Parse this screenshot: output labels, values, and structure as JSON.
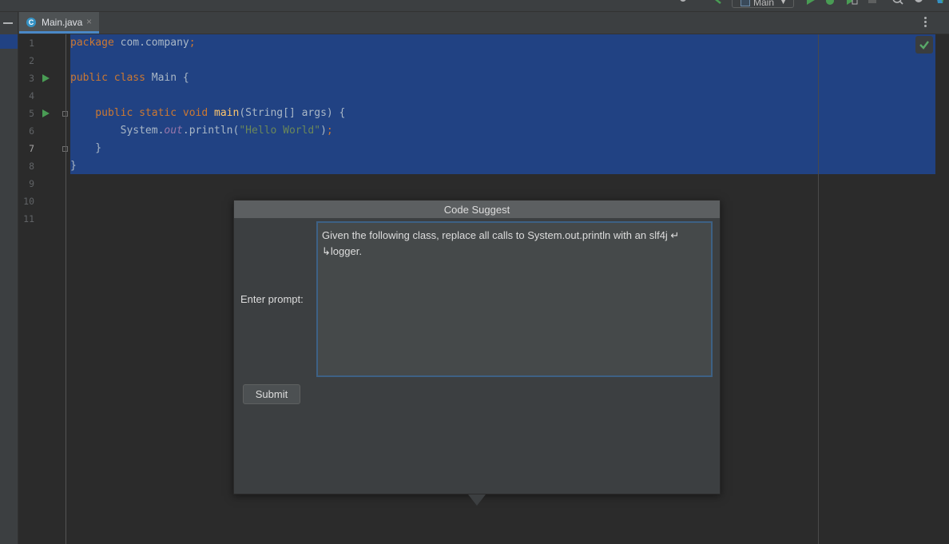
{
  "toolbar": {
    "run_config": "Main"
  },
  "tab": {
    "label": "Main.java",
    "close": "×",
    "icon": "java-class-icon"
  },
  "editor": {
    "line_numbers": [
      "1",
      "2",
      "3",
      "4",
      "5",
      "6",
      "7",
      "8",
      "9",
      "10",
      "11"
    ],
    "current_line": "7",
    "code": {
      "l1_kw": "package",
      "l1_rest": " com.company",
      "l1_semi": ";",
      "l3_kw": "public class",
      "l3_rest": " Main {",
      "l5_kw": "    public static void",
      "l5_fn": " main",
      "l5_rest": "(String[] args) {",
      "l6_a": "        System.",
      "l6_field": "out",
      "l6_b": ".println(",
      "l6_str": "\"Hello World\"",
      "l6_c": ")",
      "l6_semi": ";",
      "l7": "    }",
      "l8": "}"
    }
  },
  "dialog": {
    "title": "Code Suggest",
    "prompt_label": "Enter prompt:",
    "prompt_value": "Given the following class, replace all calls to System.out.println with an slf4j ↵\n↳logger.",
    "submit_label": "Submit"
  }
}
